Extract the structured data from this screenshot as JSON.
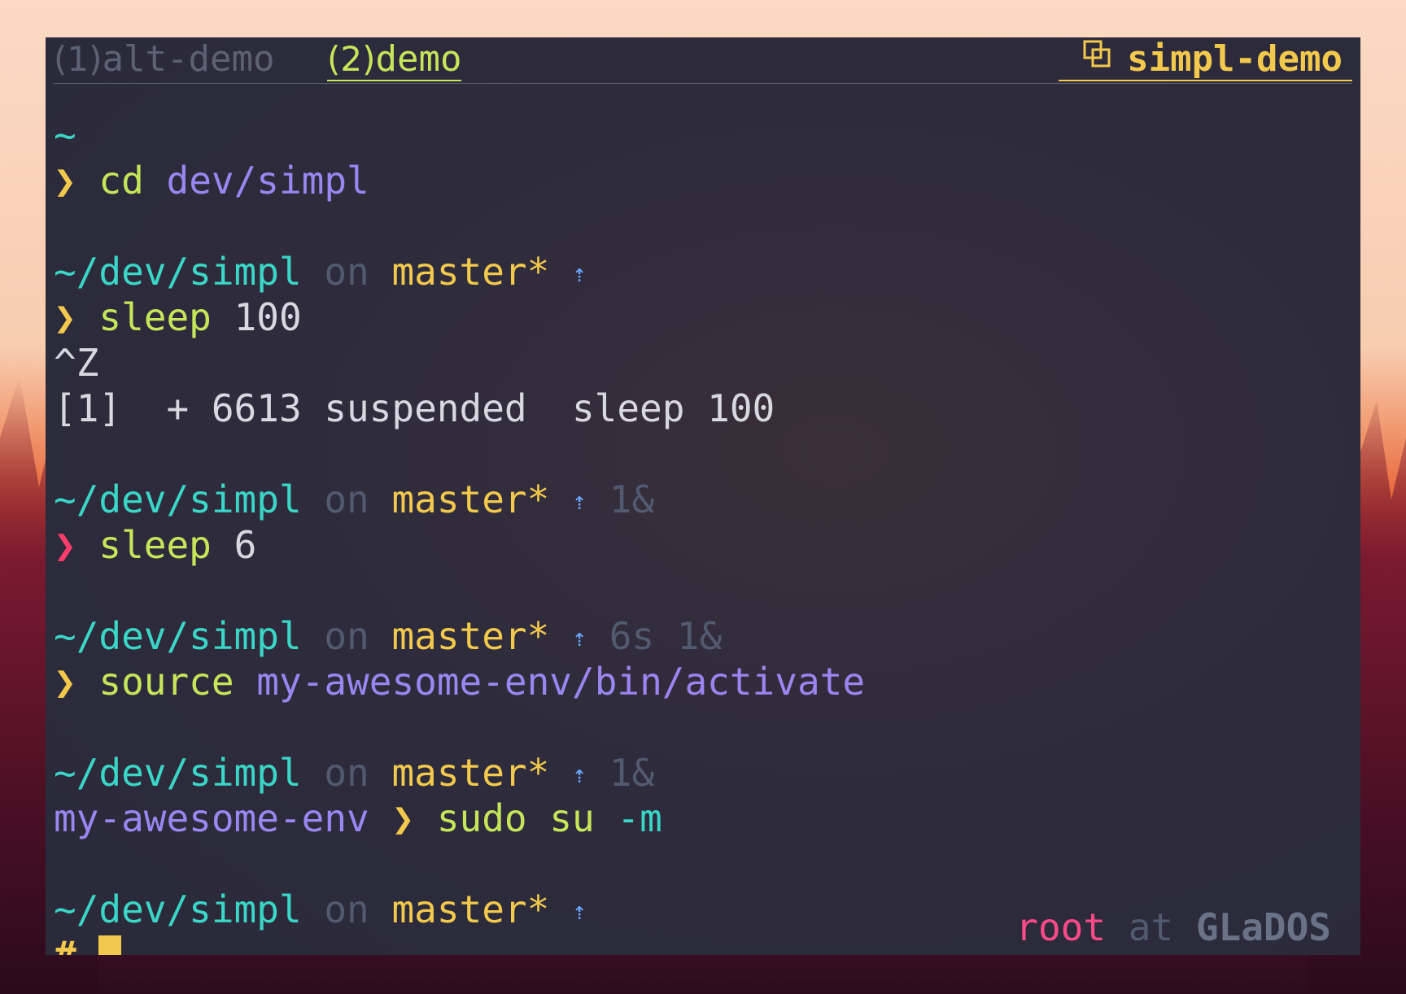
{
  "tabs": [
    {
      "num": "1",
      "label": "alt-demo",
      "active": false
    },
    {
      "num": "2",
      "label": "demo",
      "active": true
    }
  ],
  "session": {
    "icon": "window-stack-icon",
    "name": "simpl-demo"
  },
  "colors": {
    "path": "#3ad6c8",
    "branch": "#f2c94c",
    "prompt": "#f2c94c",
    "prompt_error": "#ff3d6a",
    "command": "#c6e65a",
    "argument": "#9a86f0",
    "dim": "#525a70",
    "user": "#ff4a8a"
  },
  "terminal": {
    "l1": {
      "path": "~"
    },
    "l2": {
      "prompt": "❯",
      "cmd": "cd",
      "arg": "dev/simpl"
    },
    "l4": {
      "path": "~/dev/simpl",
      "on": "on",
      "branch": "master*",
      "arrow": "⇡"
    },
    "l5": {
      "prompt": "❯",
      "cmd": "sleep",
      "arg": "100"
    },
    "l6": {
      "text": "^Z"
    },
    "l7": {
      "text": "[1]  + 6613 suspended  sleep 100"
    },
    "l9": {
      "path": "~/dev/simpl",
      "on": "on",
      "branch": "master*",
      "arrow": "⇡",
      "jobs": "1&"
    },
    "l10": {
      "prompt": "❯",
      "cmd": "sleep",
      "arg": "6"
    },
    "l12": {
      "path": "~/dev/simpl",
      "on": "on",
      "branch": "master*",
      "arrow": "⇡",
      "duration": "6s",
      "jobs": "1&"
    },
    "l13": {
      "prompt": "❯",
      "cmd": "source",
      "arg": "my-awesome-env/bin/activate"
    },
    "l15": {
      "path": "~/dev/simpl",
      "on": "on",
      "branch": "master*",
      "arrow": "⇡",
      "jobs": "1&"
    },
    "l16": {
      "venv": "my-awesome-env",
      "prompt": "❯",
      "cmd": "sudo",
      "arg": "su",
      "flag": "-m"
    },
    "l18": {
      "path": "~/dev/simpl",
      "on": "on",
      "branch": "master*",
      "arrow": "⇡"
    },
    "l19": {
      "prompt": "#"
    }
  },
  "rprompt": {
    "user": "root",
    "at": "at",
    "host": "GLaDOS"
  }
}
